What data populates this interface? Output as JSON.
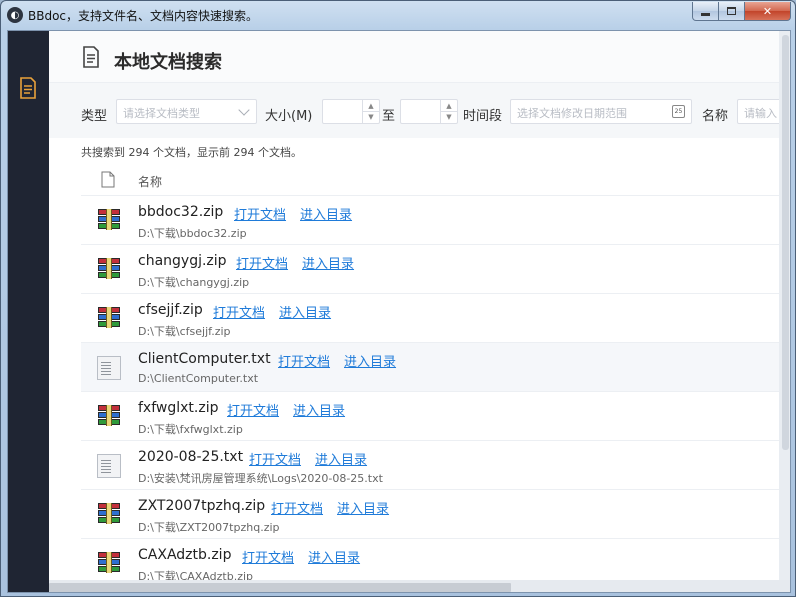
{
  "window": {
    "title": "BBdoc，支持文件名、文档内容快速搜索。",
    "app_icon": "bbdoc-logo-icon"
  },
  "sidebar": {
    "items": [
      {
        "icon": "document-icon",
        "active": true
      }
    ]
  },
  "header": {
    "title": "本地文档搜索",
    "icon": "document-icon"
  },
  "filters": {
    "type_label": "类型",
    "type_placeholder": "请选择文档类型",
    "size_label": "大小(M)",
    "to_label": "至",
    "time_label": "时间段",
    "time_placeholder": "选择文档修改日期范围",
    "name_label": "名称",
    "name_placeholder": "请输入"
  },
  "summary": "共搜索到 294 个文档，显示前 294 个文档。",
  "table": {
    "column_name": "名称",
    "open_label": "打开文档",
    "dir_label": "进入目录",
    "rows": [
      {
        "name": "bbdoc32.zip",
        "path": "D:\\下载\\bbdoc32.zip",
        "type": "zip"
      },
      {
        "name": "changygj.zip",
        "path": "D:\\下载\\changygj.zip",
        "type": "zip"
      },
      {
        "name": "cfsejjf.zip",
        "path": "D:\\下载\\cfsejjf.zip",
        "type": "zip"
      },
      {
        "name": "ClientComputer.txt",
        "path": "D:\\ClientComputer.txt",
        "type": "txt"
      },
      {
        "name": "fxfwglxt.zip",
        "path": "D:\\下载\\fxfwglxt.zip",
        "type": "zip"
      },
      {
        "name": "2020-08-25.txt",
        "path": "D:\\安装\\梵讯房屋管理系统\\Logs\\2020-08-25.txt",
        "type": "txt"
      },
      {
        "name": "ZXT2007tpzhq.zip",
        "path": "D:\\下载\\ZXT2007tpzhq.zip",
        "type": "zip"
      },
      {
        "name": "CAXAdztb.zip",
        "path": "D:\\下载\\CAXAdztb.zip",
        "type": "zip"
      }
    ]
  },
  "colors": {
    "link": "#1f7bd9",
    "sidebar_bg": "#1f2533",
    "accent": "#e9a23b"
  }
}
